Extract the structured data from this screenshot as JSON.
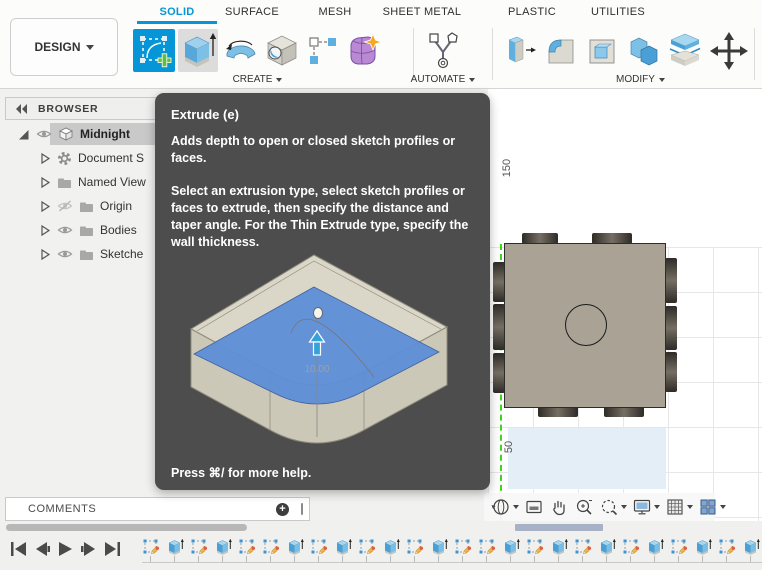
{
  "toolbar": {
    "design_label": "DESIGN",
    "tabs": [
      "SOLID",
      "SURFACE",
      "MESH",
      "SHEET METAL",
      "PLASTIC",
      "UTILITIES"
    ],
    "active_tab": "SOLID",
    "group_labels": {
      "create": "CREATE",
      "automate": "AUTOMATE",
      "modify": "MODIFY"
    }
  },
  "browser": {
    "title": "BROWSER",
    "items": [
      {
        "label": "Midnight",
        "icon": "component",
        "eye": "on",
        "disclosure": "expanded",
        "selected": true
      },
      {
        "label": "Document S",
        "icon": "gear",
        "eye": "none",
        "disclosure": "collapsed",
        "selected": false
      },
      {
        "label": "Named View",
        "icon": "folder",
        "eye": "none",
        "disclosure": "collapsed",
        "selected": false
      },
      {
        "label": "Origin",
        "icon": "folder",
        "eye": "off",
        "disclosure": "collapsed",
        "selected": false
      },
      {
        "label": "Bodies",
        "icon": "folder",
        "eye": "on",
        "disclosure": "collapsed",
        "selected": false
      },
      {
        "label": "Sketche",
        "icon": "folder",
        "eye": "on",
        "disclosure": "collapsed",
        "selected": false
      }
    ]
  },
  "tooltip": {
    "title": "Extrude (e)",
    "body1": "Adds depth to open or closed sketch profiles or faces.",
    "body2": "Select an extrusion type, select sketch profiles or faces to extrude, then specify the distance and taper angle. For the Thin Extrude type, specify the wall thickness.",
    "dimension_label": "10.00",
    "footer": "Press ⌘/ for more help."
  },
  "viewport": {
    "ruler_top": "150",
    "ruler_bottom": "50"
  },
  "comments": {
    "label": "COMMENTS"
  },
  "timeline": {
    "features": [
      "sketch",
      "extrude",
      "sketch",
      "extrude",
      "sketch",
      "sketch",
      "extrude",
      "sketch",
      "extrude",
      "sketch",
      "extrude",
      "sketch",
      "extrude",
      "sketch",
      "sketch",
      "extrude",
      "sketch",
      "extrude",
      "sketch",
      "extrude",
      "sketch",
      "extrude",
      "sketch",
      "extrude",
      "sketch",
      "extrude"
    ]
  },
  "colors": {
    "accent": "#0696d7",
    "tooltip_bg": "#4d4d4d",
    "axis_green": "#3fd41f",
    "profile_blue": "#5e8fd8",
    "part_taupe": "#a9a295"
  }
}
